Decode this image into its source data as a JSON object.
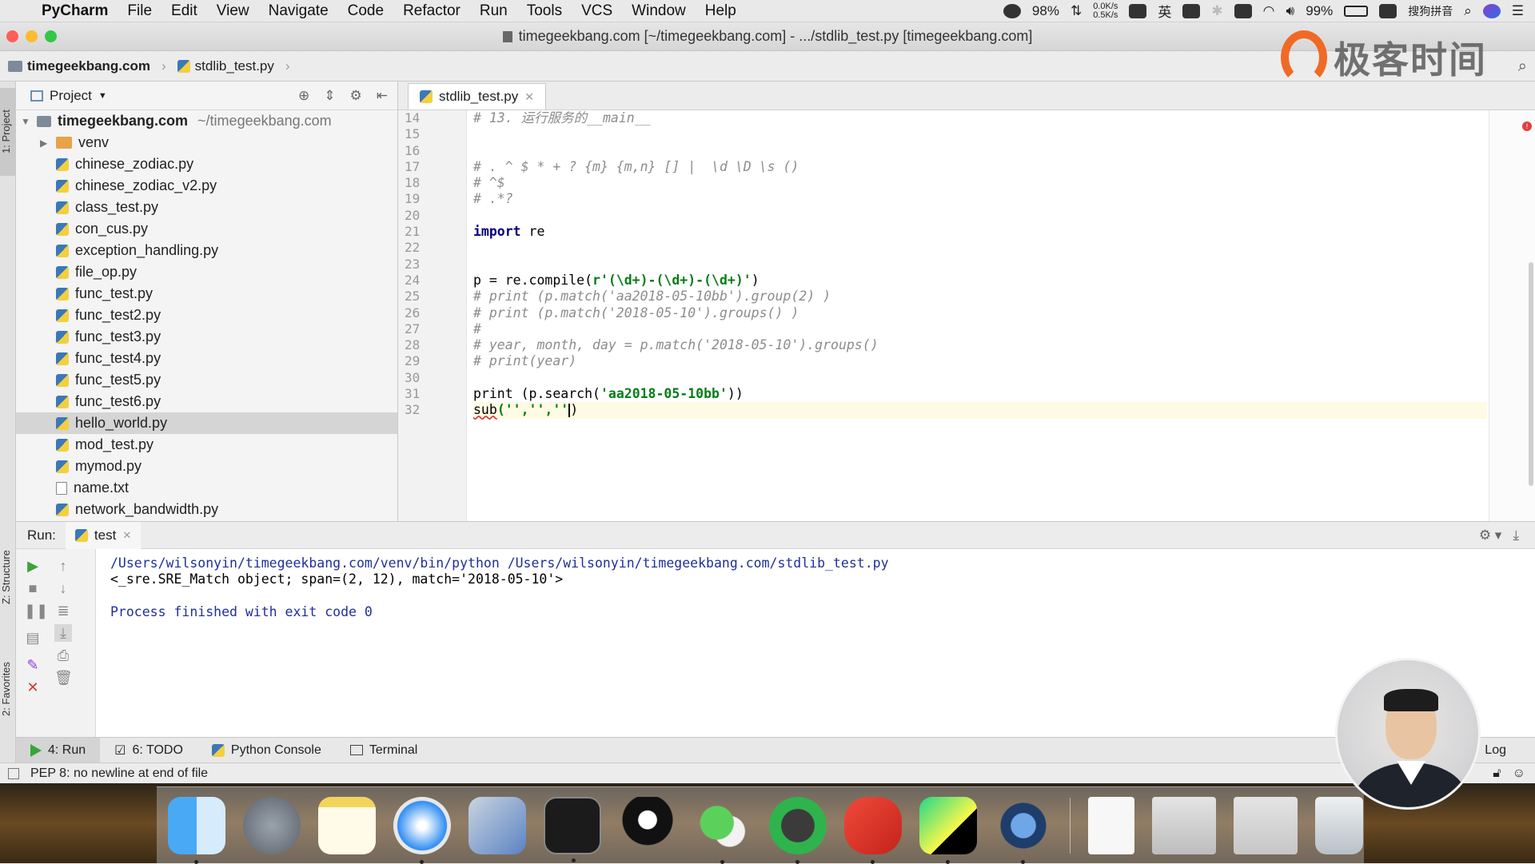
{
  "menubar": {
    "app_name": "PyCharm",
    "menus": [
      "File",
      "Edit",
      "View",
      "Navigate",
      "Code",
      "Refactor",
      "Run",
      "Tools",
      "VCS",
      "Window",
      "Help"
    ],
    "cpu_percent": "98%",
    "net_up": "0.0K/s",
    "net_down": "0.5K/s",
    "input_lang": "英",
    "battery": "99%",
    "ime": "搜狗拼音"
  },
  "window": {
    "title": "timegeekbang.com [~/timegeekbang.com] - .../stdlib_test.py [timegeekbang.com]"
  },
  "navbar": {
    "project": "timegeekbang.com",
    "file": "stdlib_test.py",
    "brand_text": "极客时间"
  },
  "left_strip": {
    "project_tab": "1: Project",
    "structure_tab": "Z: Structure",
    "favorites_tab": "2: Favorites"
  },
  "project_panel": {
    "header": "Project",
    "root_name": "timegeekbang.com",
    "root_path": "~/timegeekbang.com",
    "folder": "venv",
    "files": [
      "chinese_zodiac.py",
      "chinese_zodiac_v2.py",
      "class_test.py",
      "con_cus.py",
      "exception_handling.py",
      "file_op.py",
      "func_test.py",
      "func_test2.py",
      "func_test3.py",
      "func_test4.py",
      "func_test5.py",
      "func_test6.py",
      "hello_world.py",
      "mod_test.py",
      "mymod.py",
      "name.txt",
      "network_bandwidth.py"
    ],
    "selected_file": "hello_world.py"
  },
  "editor": {
    "tab": "stdlib_test.py",
    "line_numbers": [
      "14",
      "15",
      "16",
      "17",
      "18",
      "19",
      "20",
      "21",
      "22",
      "23",
      "24",
      "25",
      "26",
      "27",
      "28",
      "29",
      "30",
      "31",
      "32"
    ],
    "lines": {
      "l14": "# 13. 运行服务的__main__",
      "l17": "# . ^ $ * + ? {m} {m,n} [] |  \\d \\D \\s ()",
      "l18": "# ^$",
      "l19": "# .*?",
      "l21_kw": "import",
      "l21_rest": " re",
      "l24_a": "p = re.compile(",
      "l24_str": "r'(\\d+)-(\\d+)-(\\d+)'",
      "l24_b": ")",
      "l25": "# print (p.match('aa2018-05-10bb').group(2) )",
      "l26": "# print (p.match('2018-05-10').groups() )",
      "l27": "#",
      "l28": "# year, month, day = p.match('2018-05-10').groups()",
      "l29": "# print(year)",
      "l31_a": "print (p.search(",
      "l31_str": "'aa2018-05-10bb'",
      "l31_b": "))",
      "l32_a": "sub",
      "l32_str": "('','',''",
      "l32_b": ")"
    }
  },
  "run_panel": {
    "label": "Run:",
    "tab": "test",
    "console": [
      "/Users/wilsonyin/timegeekbang.com/venv/bin/python /Users/wilsonyin/timegeekbang.com/stdlib_test.py",
      "<_sre.SRE_Match object; span=(2, 12), match='2018-05-10'>",
      "",
      "Process finished with exit code 0"
    ]
  },
  "bottom_tools": {
    "run": "4: Run",
    "todo": "6: TODO",
    "python_console": "Python Console",
    "terminal": "Terminal",
    "event_log": "Log"
  },
  "statusbar": {
    "message": "PEP 8: no newline at end of file"
  },
  "dock": {
    "apps": [
      "finder-icon",
      "launchpad-icon",
      "notes-icon",
      "safari-icon",
      "network-radar-icon",
      "terminal-icon",
      "qq-icon",
      "wechat-icon",
      "evernote-icon",
      "wps-icon",
      "pycharm-icon",
      "quicktime-icon",
      "txt-file-icon",
      "screenshot-1-icon",
      "screenshot-2-icon",
      "trash-icon"
    ]
  },
  "colors": {
    "keyword": "#000080",
    "string": "#067d17",
    "comment": "#8c8c8c",
    "console_path": "#1e2f9c",
    "brand_orange": "#f06a25"
  }
}
